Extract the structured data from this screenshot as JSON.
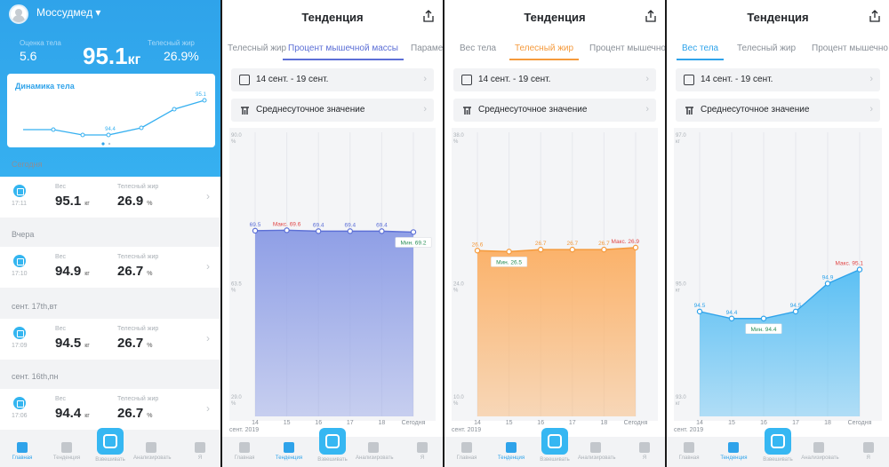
{
  "home": {
    "user_name": "Моссудмед ▾",
    "stats": {
      "body_score_label": "Оценка тела",
      "body_score_value": "5.6",
      "weight_value": "95.1",
      "weight_unit": "кг",
      "fat_label": "Телесный жир",
      "fat_value": "26.9%"
    },
    "dynamics_card": {
      "title": "Динамика тела",
      "label_min": "94.4",
      "label_last": "95.1"
    },
    "sections": [
      {
        "date": "Сегодня",
        "time": "17:11",
        "weight": "95.1",
        "fat": "26.9"
      },
      {
        "date": "Вчера",
        "time": "17:10",
        "weight": "94.9",
        "fat": "26.7"
      },
      {
        "date": "сент. 17th,вт",
        "time": "17:09",
        "weight": "94.5",
        "fat": "26.7"
      },
      {
        "date": "сент. 16th,пн",
        "time": "17:06",
        "weight": "94.4",
        "fat": "26.7"
      }
    ],
    "weight_label": "Вес",
    "weight_unit": "кг",
    "fat_label": "Телесный жир",
    "fat_unit": "%"
  },
  "nav": {
    "items": [
      "Главная",
      "Тенденция",
      "Взвешивать",
      "Анализировать",
      "Я"
    ]
  },
  "tendency": {
    "title": "Тенденция",
    "date_range": "14 сент. - 19 сент.",
    "average_label": "Среднесуточное значение",
    "month_label": "сент. 2019",
    "panels": [
      {
        "tabs": [
          "Телесный жир",
          "Процент мышечной массы",
          "Параме"
        ],
        "active_tab": 1,
        "accent": "#5c6fd6"
      },
      {
        "tabs": [
          "Вес тела",
          "Телесный жир",
          "Процент мышечно"
        ],
        "active_tab": 1,
        "accent": "#f59a3c"
      },
      {
        "tabs": [
          "Вес тела",
          "Телесный жир",
          "Процент мышечно"
        ],
        "active_tab": 0,
        "accent": "#2fa3ea"
      }
    ]
  },
  "chart_data": [
    {
      "type": "area",
      "title": "Процент мышечной массы",
      "unit": "%",
      "y_ticks": [
        "90.0",
        "63.5",
        "29.0"
      ],
      "x": [
        "14",
        "15",
        "16",
        "17",
        "18",
        "Сегодня"
      ],
      "values": [
        69.5,
        69.6,
        69.4,
        69.4,
        69.4,
        69.2
      ],
      "value_labels": [
        "69.5",
        "Макс. 69.6",
        "69.4",
        "69.4",
        "69.4",
        "Мин. 69.2"
      ],
      "max_label": "Макс. 69.6",
      "min_label": "Мин. 69.2",
      "ylim": [
        29.0,
        90.0
      ],
      "color": "#8f9fe6"
    },
    {
      "type": "area",
      "title": "Телесный жир",
      "unit": "%",
      "y_ticks": [
        "38.0",
        "24.0",
        "10.0"
      ],
      "x": [
        "14",
        "15",
        "16",
        "17",
        "18",
        "Сегодня"
      ],
      "values": [
        26.6,
        26.5,
        26.7,
        26.7,
        26.7,
        26.9
      ],
      "value_labels": [
        "26.6",
        "Мин. 26.5",
        "26.7",
        "26.7",
        "26.7",
        "Макс. 26.9"
      ],
      "max_label": "Макс. 26.9",
      "min_label": "Мин. 26.5",
      "ylim": [
        10.0,
        38.0
      ],
      "color": "#fbb26a"
    },
    {
      "type": "area",
      "title": "Вес тела",
      "unit": "кг",
      "y_ticks": [
        "97.0",
        "95.0",
        "93.0"
      ],
      "x": [
        "14",
        "15",
        "16",
        "17",
        "18",
        "Сегодня"
      ],
      "values": [
        94.5,
        94.4,
        94.4,
        94.5,
        94.9,
        95.1
      ],
      "value_labels": [
        "94.5",
        "94.4",
        "Мин. 94.4",
        "94.5",
        "94.9",
        "Макс. 95.1"
      ],
      "max_label": "Макс. 95.1",
      "min_label": "Мин. 94.4",
      "ylim": [
        93.0,
        97.0
      ],
      "color": "#5cc0f4"
    }
  ]
}
